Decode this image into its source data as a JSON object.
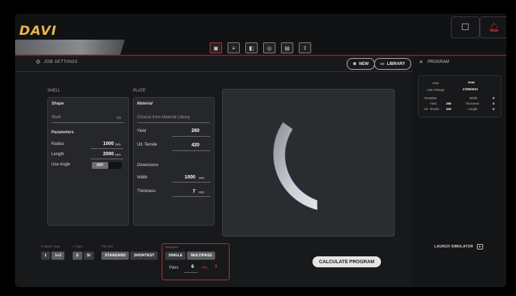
{
  "app": {
    "logo": "DAVI"
  },
  "header": {
    "toolbar_icons": [
      "job-settings-icon",
      "list-icon",
      "tool-icon",
      "roll-icon",
      "machine-icon",
      "export-icon"
    ],
    "right_buttons": [
      "note-icon",
      "bell-icon"
    ]
  },
  "subbar": {
    "title": "JOB SETTINGS",
    "new_label": "NEW",
    "library_label": "LIBRARY"
  },
  "shell": {
    "section": "SHELL",
    "shape_title": "Shape",
    "shape_value": "Shell",
    "params_title": "Parameters",
    "radius_label": "Radius",
    "radius_value": "1000",
    "radius_unit": "mm",
    "length_label": "Length",
    "length_value": "2000",
    "length_unit": "mm",
    "angle_label": "Use Angle",
    "angle_toggle": "OFF"
  },
  "plate": {
    "section": "PLATE",
    "material_title": "Material",
    "material_placeholder": "Choose from Material Library",
    "yield_label": "Yield",
    "yield_value": "260",
    "ult_label": "Ult. Tensile",
    "ult_value": "420",
    "dims_title": "Dimensions",
    "width_label": "Width",
    "width_value": "1000",
    "width_unit": "mm",
    "thick_label": "Thickness",
    "thick_value": "7",
    "thick_unit": "mm"
  },
  "program": {
    "title": "PROGRAM",
    "user_label": "User",
    "user_value": "User",
    "last_change_label": "Last Change",
    "last_change_value": "17/06/2021",
    "template_label": "Template",
    "width_label": "Width",
    "width_value": "0",
    "yield_label": "Yield",
    "yield_value": "260",
    "thickness_label": "Thickness",
    "thickness_value": "0",
    "ult_label": "Ult. Tensile",
    "ult_value": "420",
    "length_label": "Length",
    "length_value": "0",
    "launch_label": "LAUNCH SIMULATOR"
  },
  "controls": {
    "problem_type_label": "Problem Type",
    "problem_options": [
      "1",
      "1+2"
    ],
    "units_label": "Y Type",
    "units_options": [
      "S",
      "SI"
    ],
    "flat_end_label": "Flat End",
    "flat_end_options": [
      "STANDARD",
      "SHORTEST"
    ],
    "multipass_label": "Multipass",
    "multipass_options": [
      "SINGLE",
      "MULTIPASS"
    ],
    "pass_label": "Pass",
    "pass_value": "6",
    "min_label": "Min.",
    "min_value": "3",
    "calc_label": "CALCULATE PROGRAM"
  },
  "colors": {
    "accent_red": "#c0313a",
    "logo_gold": "#e8b24a"
  }
}
